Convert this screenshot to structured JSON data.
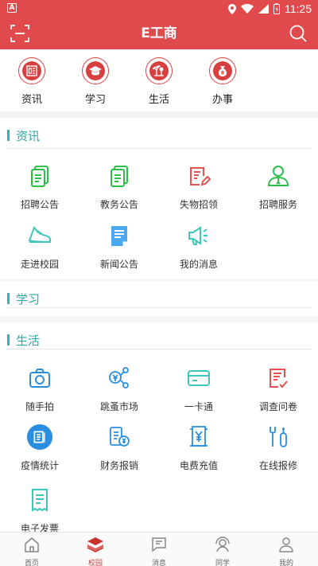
{
  "status_bar": {
    "time": "11:25",
    "badge": "A"
  },
  "app_bar": {
    "title": "E工商"
  },
  "top_categories": [
    {
      "label": "资讯",
      "icon": "news-icon"
    },
    {
      "label": "学习",
      "icon": "graduation-cap-icon"
    },
    {
      "label": "生活",
      "icon": "life-icon"
    },
    {
      "label": "办事",
      "icon": "money-bag-icon"
    }
  ],
  "sections": {
    "news": {
      "title": "资讯",
      "items": [
        {
          "label": "招聘公告",
          "icon": "document-icon"
        },
        {
          "label": "教务公告",
          "icon": "document-icon"
        },
        {
          "label": "失物招领",
          "icon": "edit-document-icon"
        },
        {
          "label": "招聘服务",
          "icon": "person-icon"
        },
        {
          "label": "走进校园",
          "icon": "sneaker-icon"
        },
        {
          "label": "新闻公告",
          "icon": "article-icon"
        },
        {
          "label": "我的消息",
          "icon": "megaphone-icon"
        }
      ]
    },
    "study": {
      "title": "学习",
      "items": []
    },
    "life": {
      "title": "生活",
      "items": [
        {
          "label": "随手拍",
          "icon": "camera-icon"
        },
        {
          "label": "跳蚤市场",
          "icon": "market-icon"
        },
        {
          "label": "一卡通",
          "icon": "card-icon"
        },
        {
          "label": "调查问卷",
          "icon": "survey-icon"
        },
        {
          "label": "疫情统计",
          "icon": "statistics-icon"
        },
        {
          "label": "财务报销",
          "icon": "reimbursement-icon"
        },
        {
          "label": "电费充值",
          "icon": "electricity-bill-icon"
        },
        {
          "label": "在线报修",
          "icon": "repair-tools-icon"
        },
        {
          "label": "电子发票",
          "icon": "invoice-icon"
        }
      ]
    }
  },
  "tab_bar": {
    "active": "校园",
    "tabs": [
      {
        "label": "首页",
        "icon": "home-icon"
      },
      {
        "label": "校园",
        "icon": "campus-stack-icon"
      },
      {
        "label": "消息",
        "icon": "message-icon"
      },
      {
        "label": "同学",
        "icon": "classmates-icon"
      },
      {
        "label": "我的",
        "icon": "profile-icon"
      }
    ]
  },
  "colors": {
    "brand_red": "#e04a4c",
    "section_teal": "#29a6a8",
    "icon_green": "#2cbf4a",
    "icon_blue": "#2a8ee0",
    "icon_red": "#e8504f"
  }
}
